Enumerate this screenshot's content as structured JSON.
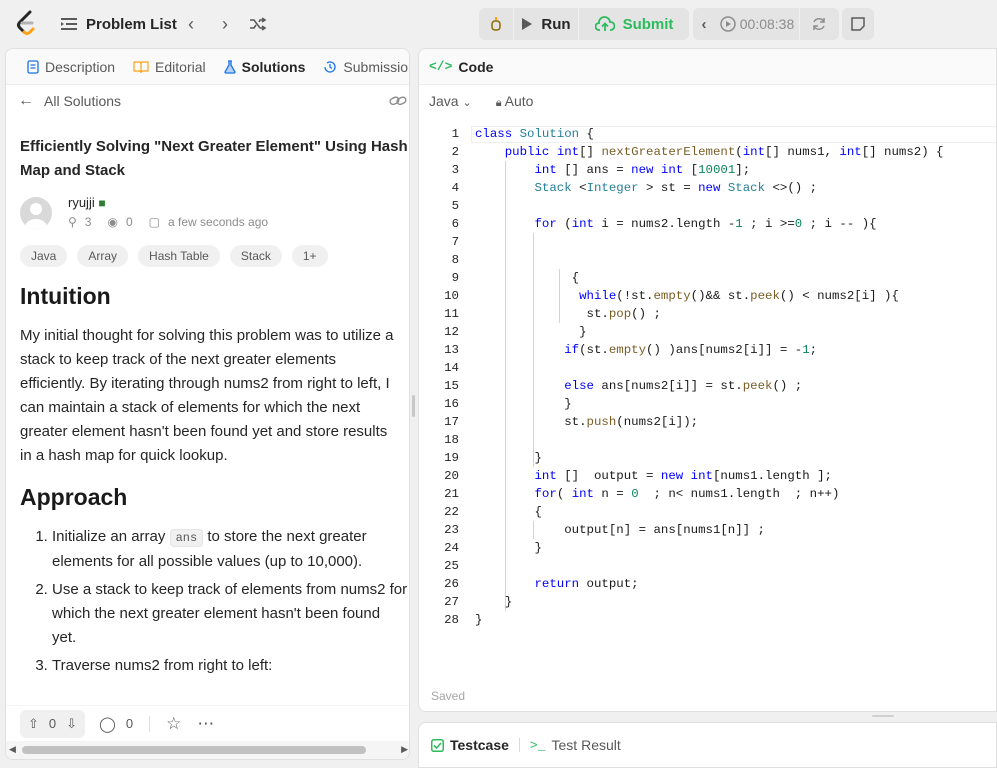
{
  "topbar": {
    "problem_list_label": "Problem List",
    "run_label": "Run",
    "submit_label": "Submit",
    "timer": "00:08:38"
  },
  "left": {
    "tabs": [
      {
        "label": "Description"
      },
      {
        "label": "Editorial"
      },
      {
        "label": "Solutions"
      },
      {
        "label": "Submission"
      }
    ],
    "all_solutions": "All Solutions",
    "title": "Efficiently Solving \"Next Greater Element\" Using Hash Map and Stack",
    "author": {
      "name": "ryujji",
      "reputation": "3",
      "views": "0",
      "time": "a few seconds ago"
    },
    "tags": [
      "Java",
      "Array",
      "Hash Table",
      "Stack",
      "1+"
    ],
    "intuition_heading": "Intuition",
    "intuition_text": "My initial thought for solving this problem was to utilize a stack to keep track of the next greater elements efficiently. By iterating through nums2 from right to left, I can maintain a stack of elements for which the next greater element hasn't been found yet and store results in a hash map for quick lookup.",
    "approach_heading": "Approach",
    "approach_items": [
      {
        "pre": "Initialize an array",
        "code": "ans",
        "post": "to store the next greater elements for all possible values (up to 10,000)."
      },
      {
        "text": "Use a stack to keep track of elements from nums2 for which the next greater element hasn't been found yet."
      },
      {
        "text": "Traverse nums2 from right to left:"
      }
    ],
    "upvotes": "0",
    "comments": "0"
  },
  "right": {
    "code_tab": "Code",
    "language": "Java",
    "mode": "Auto",
    "saved": "Saved"
  },
  "bottom": {
    "testcase": "Testcase",
    "test_result": "Test Result"
  },
  "colors": {
    "accent_green": "#2cbb5d",
    "tab_blue": "#1a73e8",
    "logo_orange": "#ffa116"
  }
}
